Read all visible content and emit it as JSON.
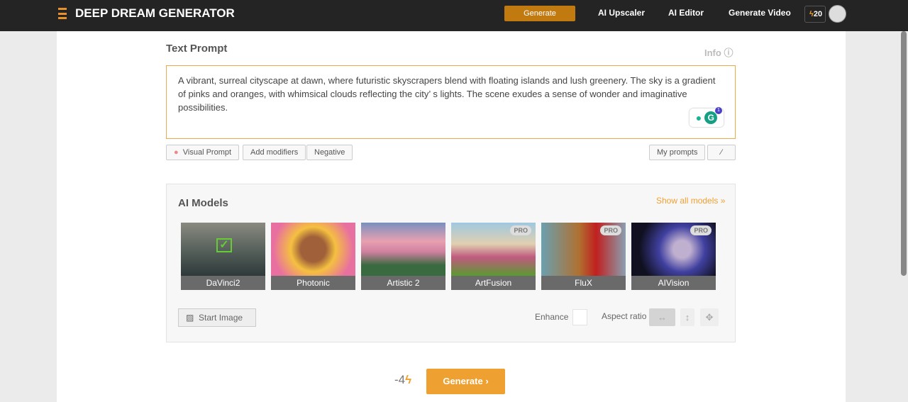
{
  "header": {
    "brand": "DEEP DREAM GENERATOR",
    "generate": "Generate",
    "links": [
      "AI Upscaler",
      "AI Editor",
      "Generate Video"
    ],
    "credits": "20"
  },
  "prompt": {
    "title": "Text Prompt",
    "info": "Info",
    "text": "A vibrant, surreal cityscape at dawn, where futuristic skyscrapers blend with floating islands and lush greenery. The sky is a gradient of pinks and oranges, with whimsical clouds reflecting the city’  s lights. The scene exudes a sense of wonder and imaginative possibilities.",
    "grammarly_count": "1"
  },
  "buttons": {
    "visual_prompt": "Visual Prompt",
    "add_modifiers": "Add modifiers",
    "negative": "Negative",
    "my_prompts": "My prompts"
  },
  "models": {
    "title": "AI Models",
    "show_all": "Show all models",
    "items": [
      {
        "name": "DaVinci2",
        "pro": ""
      },
      {
        "name": "Photonic",
        "pro": ""
      },
      {
        "name": "Artistic 2",
        "pro": ""
      },
      {
        "name": "ArtFusion",
        "pro": "PRO"
      },
      {
        "name": "FluX",
        "pro": "PRO"
      },
      {
        "name": "AIVision",
        "pro": "PRO"
      }
    ],
    "start_image": "Start Image",
    "enhance": "Enhance",
    "aspect_ratio": "Aspect ratio"
  },
  "footer": {
    "cost": "-4",
    "generate": "Generate"
  }
}
